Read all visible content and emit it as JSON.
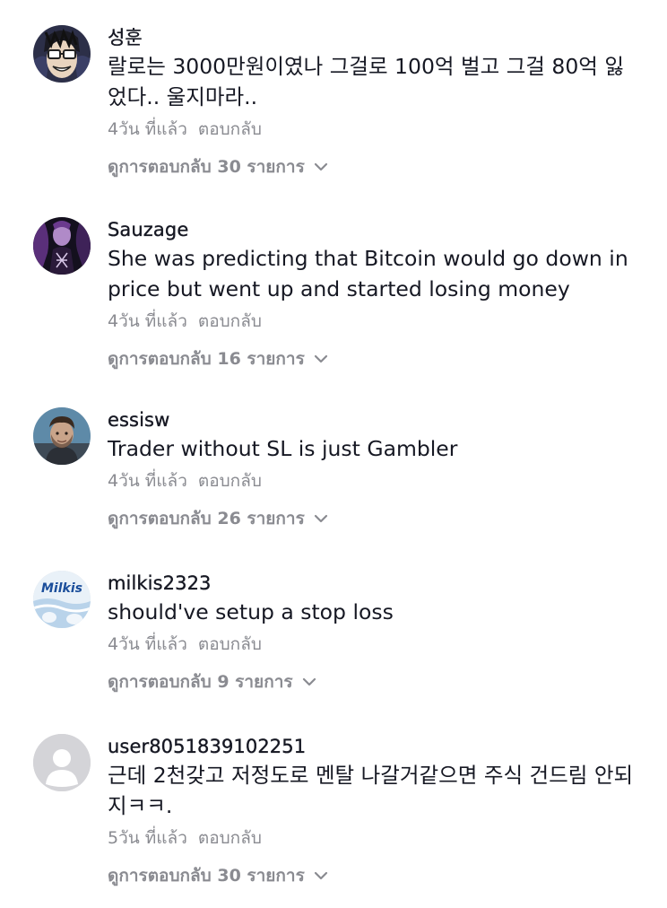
{
  "comments": [
    {
      "username": "성훈",
      "text": "랄로는 3000만원이였나 그걸로 100억 벌고 그걸 80억 잃었다.. 울지마라..",
      "time": "4วัน ที่แล้ว",
      "reply_label": "ตอบกลับ",
      "view_replies": "ดูการตอบกลับ 30 รายการ",
      "avatar": "anime-glasses-avatar"
    },
    {
      "username": "Sauzage",
      "text": "She was predicting that Bitcoin would go down in price but went up and started losing money",
      "time": "4วัน ที่แล้ว",
      "reply_label": "ตอบกลับ",
      "view_replies": "ดูการตอบกลับ 16 รายการ",
      "avatar": "purple-figure-avatar"
    },
    {
      "username": "essisw",
      "text": "Trader without SL is just Gambler",
      "time": "4วัน ที่แล้ว",
      "reply_label": "ตอบกลับ",
      "view_replies": "ดูการตอบกลับ 26 รายการ",
      "avatar": "man-portrait-avatar"
    },
    {
      "username": "milkis2323",
      "text": "should've setup a stop loss",
      "time": "4วัน ที่แล้ว",
      "reply_label": "ตอบกลับ",
      "view_replies": "ดูการตอบกลับ 9 รายการ",
      "avatar": "milkis-can-avatar"
    },
    {
      "username": "user8051839102251",
      "text": "근데 2천갖고 저정도로 멘탈 나갈거같으면 주식 건드림 안되지ㅋㅋ.",
      "time": "5วัน ที่แล้ว",
      "reply_label": "ตอบกลับ",
      "view_replies": "ดูการตอบกลับ 30 รายการ",
      "avatar": "default-user-avatar"
    }
  ],
  "colors": {
    "text_primary": "#161823",
    "text_secondary": "#8a8b91",
    "background": "#ffffff"
  }
}
